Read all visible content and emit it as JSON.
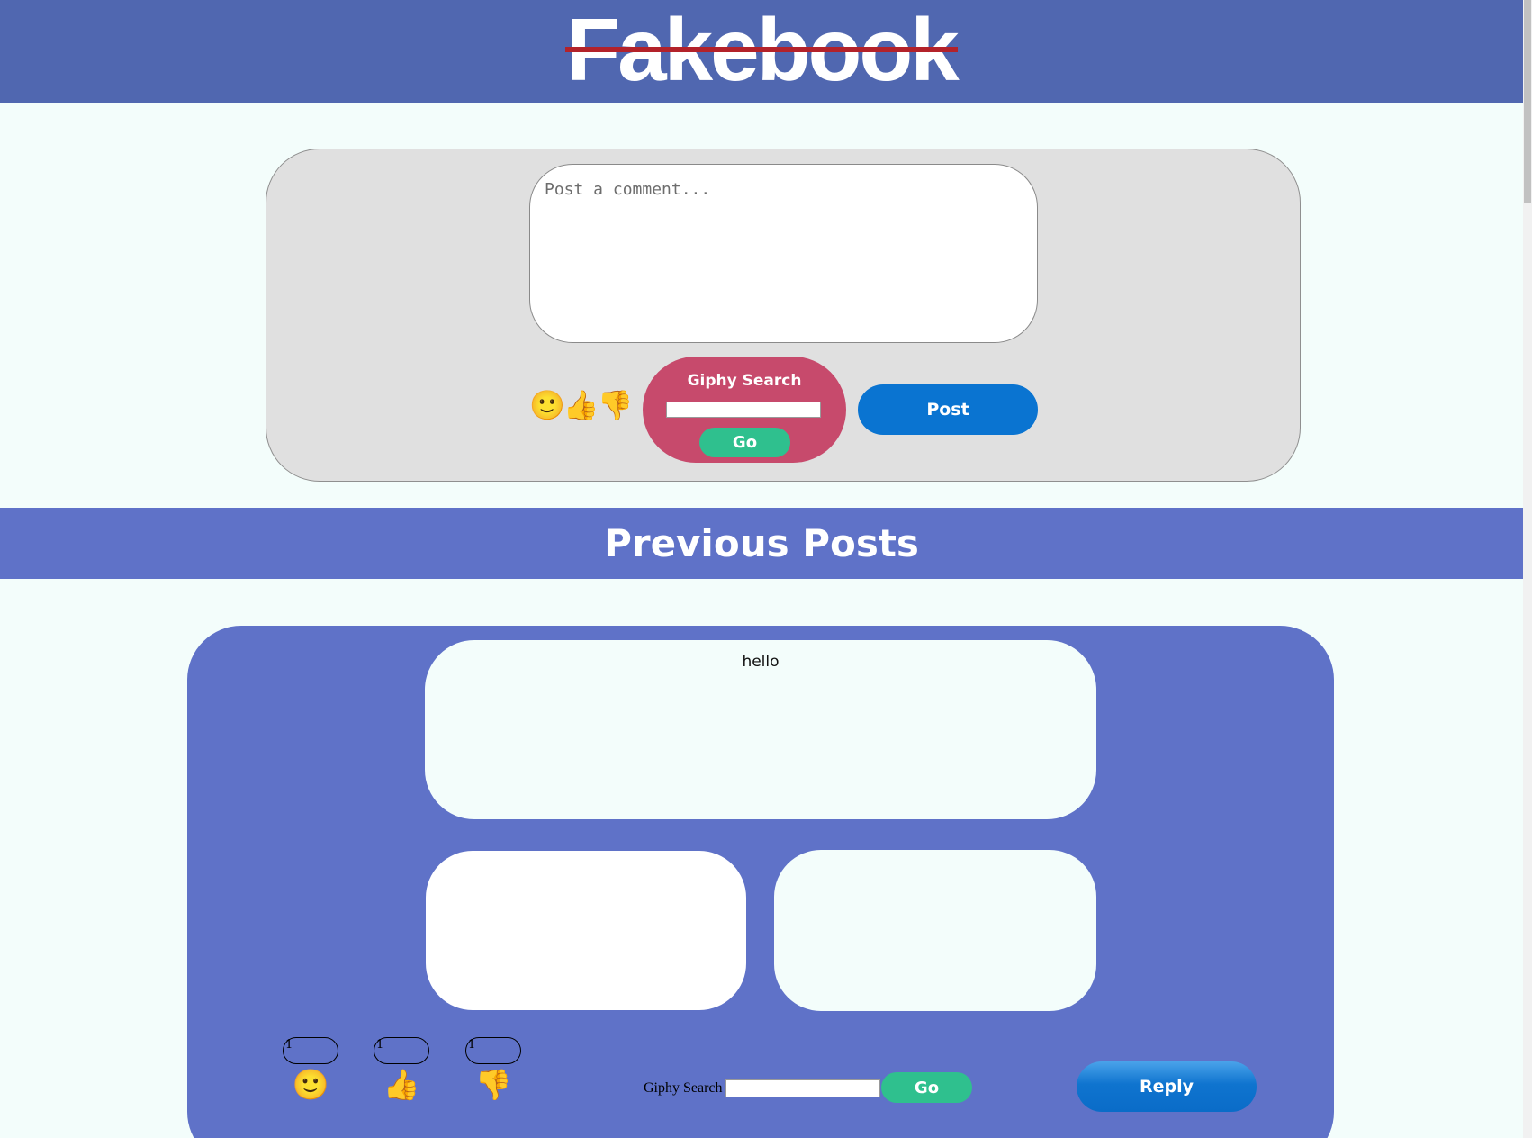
{
  "header": {
    "logo_text": "Fakebook"
  },
  "composer": {
    "comment_placeholder": "Post a comment...",
    "emojis": "🙂👍👎",
    "giphy_title": "Giphy Search",
    "giphy_go_label": "Go",
    "post_label": "Post"
  },
  "previous_posts": {
    "title": "Previous Posts"
  },
  "post": {
    "text": "hello",
    "reactions": [
      {
        "count": "1",
        "emoji": "🙂"
      },
      {
        "count": "1",
        "emoji": "👍"
      },
      {
        "count": "1",
        "emoji": "👎"
      }
    ],
    "giphy_label": "Giphy Search",
    "giphy_go_label": "Go",
    "reply_label": "Reply"
  },
  "colors": {
    "header": "#5067b0",
    "logo_strike": "#b3222a",
    "banner": "#5f72c8",
    "giphy_panel": "#c74a6c",
    "go_button": "#2fc08e",
    "primary_button": "#0a74d1"
  }
}
